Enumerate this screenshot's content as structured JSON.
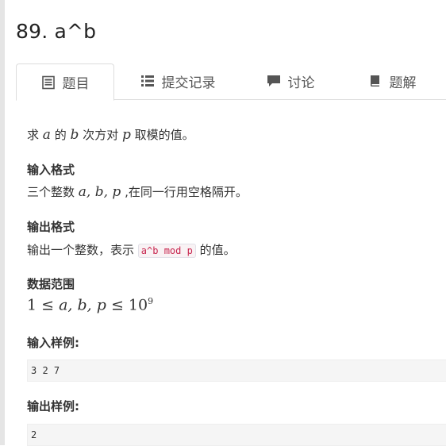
{
  "problem": {
    "title": "89. a^b"
  },
  "tabs": [
    {
      "label": "题目",
      "icon": "document-icon"
    },
    {
      "label": "提交记录",
      "icon": "list-icon"
    },
    {
      "label": "讨论",
      "icon": "comment-icon"
    },
    {
      "label": "题解",
      "icon": "book-icon"
    }
  ],
  "statement": {
    "desc_prefix": "求",
    "desc_a": "a",
    "desc_of": "的",
    "desc_b": "b",
    "desc_power_to": "次方对",
    "desc_p": "p",
    "desc_suffix": "取模的值。",
    "input_heading": "输入格式",
    "input_prefix": "三个整数",
    "input_vars": "a, b, p",
    "input_suffix": ",在同一行用空格隔开。",
    "output_heading": "输出格式",
    "output_prefix": "输出一个整数，表示",
    "output_code": "a^b mod p",
    "output_suffix": "的值。",
    "range_heading": "数据范围",
    "range_formula_left": "1 ≤ ",
    "range_formula_vars": "a, b, p",
    "range_formula_right": " ≤ 10",
    "range_formula_exp": "9",
    "sample_input_heading": "输入样例:",
    "sample_input": "3 2 7",
    "sample_output_heading": "输出样例:",
    "sample_output": "2"
  }
}
